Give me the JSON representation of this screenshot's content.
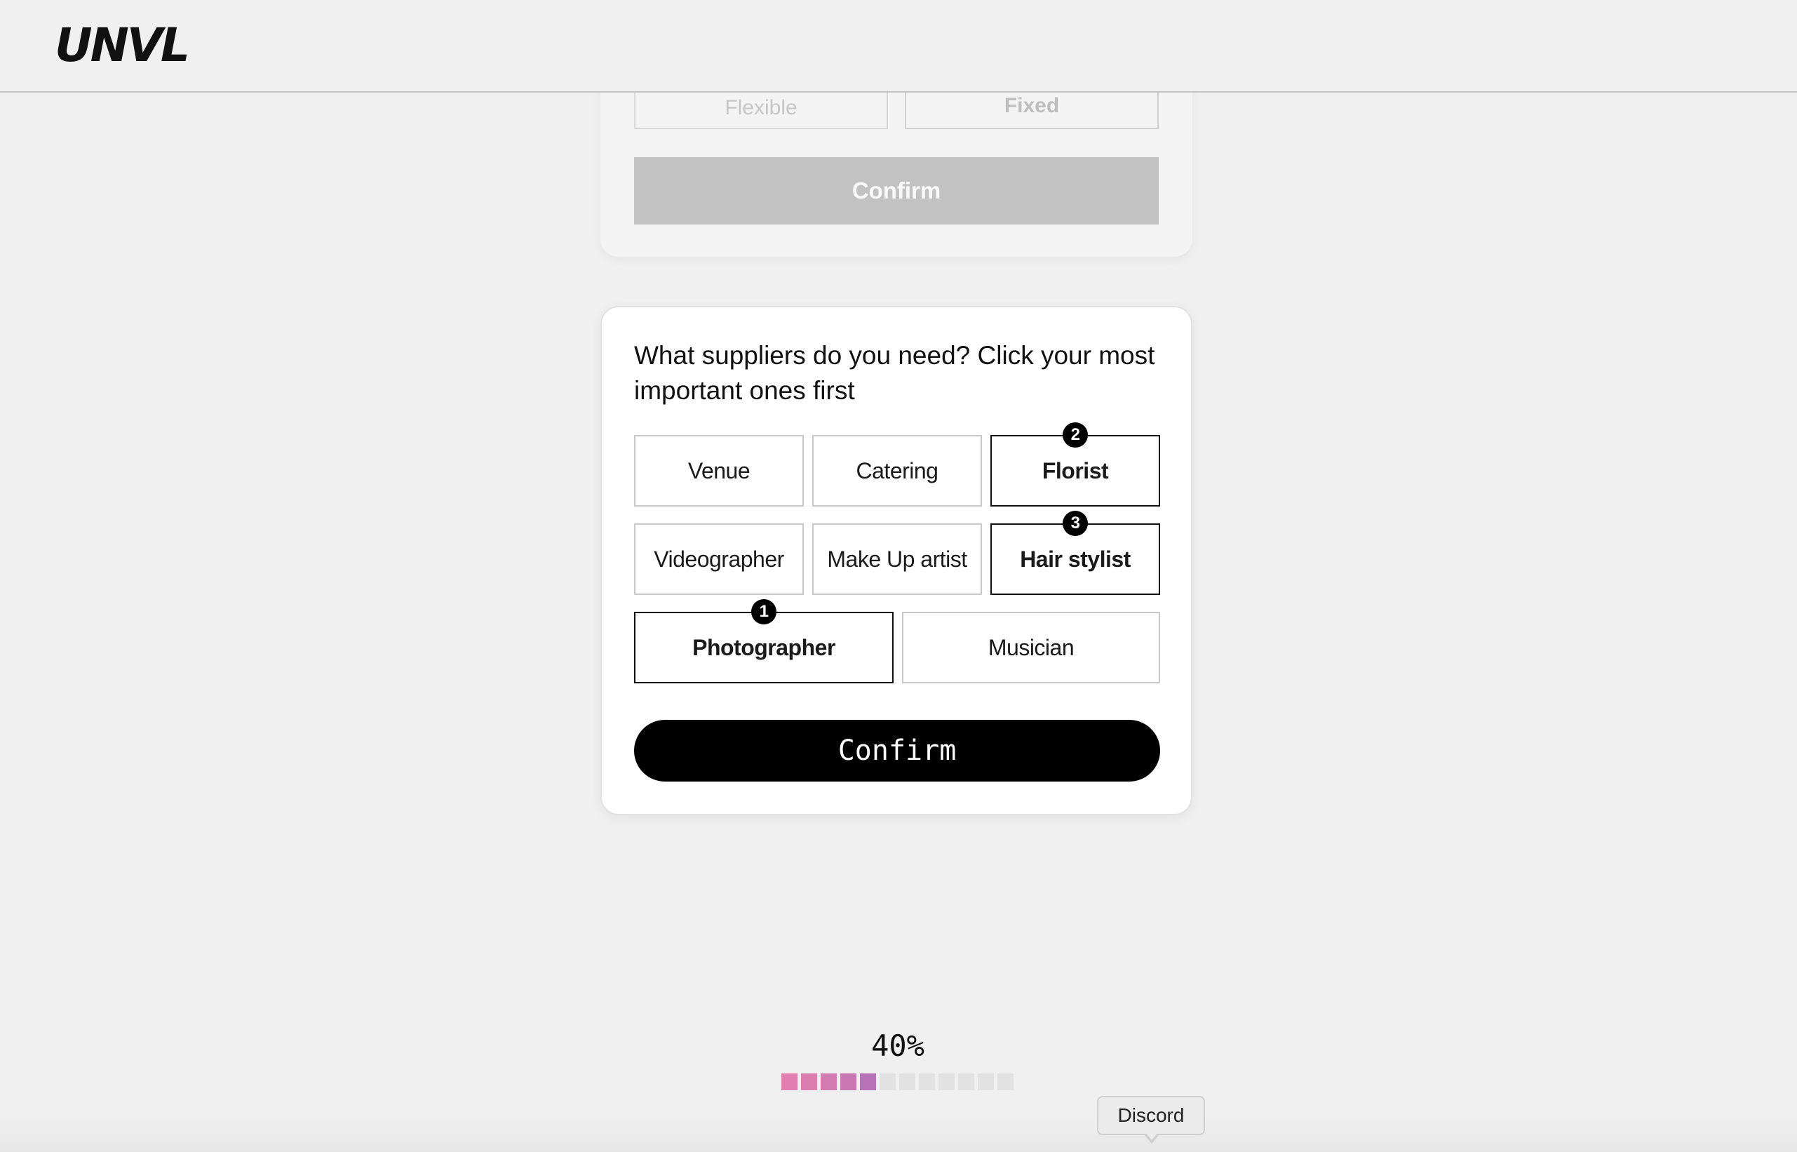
{
  "header": {
    "logo": "UNVL"
  },
  "previous_card": {
    "options": [
      "Flexible",
      "Fixed"
    ],
    "confirm_label": "Confirm"
  },
  "question_card": {
    "question": "What suppliers do you need? Click your most important ones first",
    "options": [
      {
        "label": "Venue",
        "selected": false,
        "rank": ""
      },
      {
        "label": "Catering",
        "selected": false,
        "rank": ""
      },
      {
        "label": "Florist",
        "selected": true,
        "rank": "2"
      },
      {
        "label": "Videographer",
        "selected": false,
        "rank": ""
      },
      {
        "label": "Make Up artist",
        "selected": false,
        "rank": ""
      },
      {
        "label": "Hair stylist",
        "selected": true,
        "rank": "3"
      },
      {
        "label": "Photographer",
        "selected": true,
        "rank": "1"
      },
      {
        "label": "Musician",
        "selected": false,
        "rank": ""
      }
    ],
    "confirm_label": "Confirm"
  },
  "progress": {
    "label": "40%",
    "value": 0.4,
    "segments_total": 12,
    "segments_filled": 5,
    "filled_colors": [
      "#e07fb0",
      "#dc7db0",
      "#d27bb1",
      "#c978b4",
      "#b873b8"
    ],
    "empty_color": "#e2e2e2"
  },
  "tooltip": {
    "label": "Discord"
  }
}
